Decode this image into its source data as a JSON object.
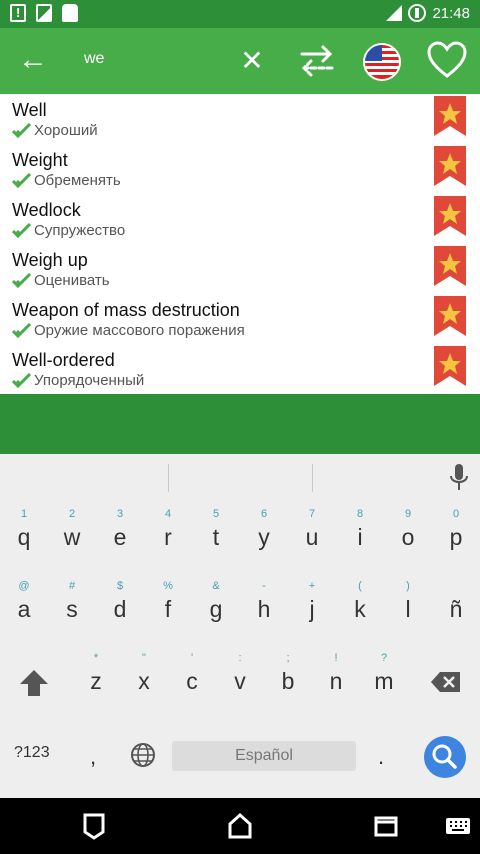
{
  "status_bar": {
    "left_icons": [
      "alert-icon",
      "image-icon",
      "android-icon"
    ],
    "time": "21:48"
  },
  "toolbar": {
    "query": "we",
    "back_icon": "arrow-left-icon",
    "clear_icon": "close-icon",
    "swap_icon": "swap-direction-icon",
    "flag_icon": "us-flag-icon",
    "favorite_icon": "heart-icon",
    "color": "#46ad48"
  },
  "results": [
    {
      "word": "Well",
      "translation": "Хороший"
    },
    {
      "word": "Weight",
      "translation": "Обременять"
    },
    {
      "word": "Wedlock",
      "translation": "Супружество"
    },
    {
      "word": "Weigh up",
      "translation": "Оценивать"
    },
    {
      "word": "Weapon of mass destruction",
      "translation": "Оружие массового поражения"
    },
    {
      "word": "Well-ordered",
      "translation": "Упорядоченный"
    }
  ],
  "keyboard": {
    "row1": [
      {
        "hint": "1",
        "key": "q"
      },
      {
        "hint": "2",
        "key": "w"
      },
      {
        "hint": "3",
        "key": "e"
      },
      {
        "hint": "4",
        "key": "r"
      },
      {
        "hint": "5",
        "key": "t"
      },
      {
        "hint": "6",
        "key": "y"
      },
      {
        "hint": "7",
        "key": "u"
      },
      {
        "hint": "8",
        "key": "i"
      },
      {
        "hint": "9",
        "key": "o"
      },
      {
        "hint": "0",
        "key": "p"
      }
    ],
    "row2": [
      {
        "hint": "@",
        "key": "a"
      },
      {
        "hint": "#",
        "key": "s"
      },
      {
        "hint": "$",
        "key": "d"
      },
      {
        "hint": "%",
        "key": "f"
      },
      {
        "hint": "&",
        "key": "g"
      },
      {
        "hint": "-",
        "key": "h"
      },
      {
        "hint": "+",
        "key": "j"
      },
      {
        "hint": "(",
        "key": "k"
      },
      {
        "hint": ")",
        "key": "l"
      },
      {
        "hint": "",
        "key": "ñ"
      }
    ],
    "row3": [
      {
        "hint": "*",
        "key": "z"
      },
      {
        "hint": "\"",
        "key": "x"
      },
      {
        "hint": "'",
        "key": "c"
      },
      {
        "hint": ":",
        "key": "v"
      },
      {
        "hint": ";",
        "key": "b"
      },
      {
        "hint": "!",
        "key": "n"
      },
      {
        "hint": "?",
        "key": "m"
      }
    ],
    "symbols_label": "?123",
    "comma": ",",
    "space_label": "Español",
    "period": ".",
    "accent": "#3d85e0"
  },
  "nav_bar": {
    "icons": [
      "back-icon",
      "home-icon",
      "recents-icon",
      "keyboard-switch-icon"
    ]
  }
}
